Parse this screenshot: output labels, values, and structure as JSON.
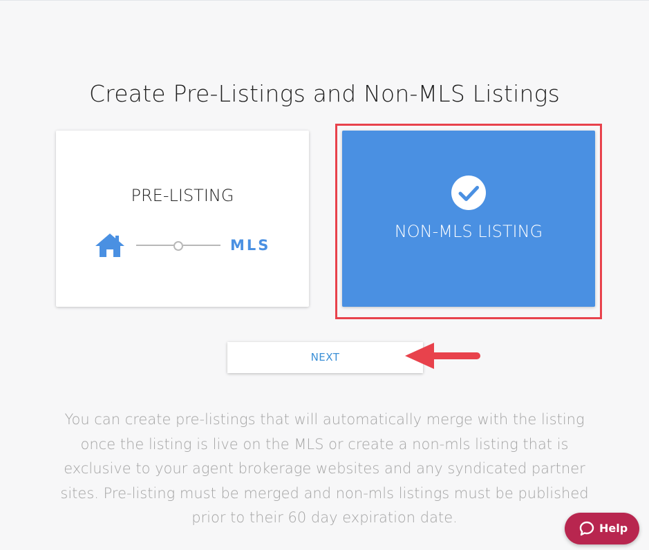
{
  "page": {
    "title": "Create Pre-Listings and Non-MLS Listings"
  },
  "cards": {
    "pre_listing": {
      "label": "PRE-LISTING",
      "icon": "home-icon",
      "mls_label": "MLS",
      "selected": false
    },
    "non_mls": {
      "label": "NON-MLS LISTING",
      "icon": "checkmark-circle-icon",
      "selected": true
    }
  },
  "actions": {
    "next_label": "NEXT"
  },
  "description": "You can create pre-listings that will automatically merge with the listing once the listing is live on the MLS or create a non-mls listing that is exclusive to your agent brokerage websites and any syndicated partner sites. Pre-listing must be merged and non-mls listings must be published prior to their 60 day expiration date.",
  "help": {
    "label": "Help",
    "icon": "chat-bubble-icon"
  },
  "colors": {
    "background": "#f7f7f8",
    "accent_blue": "#4a90e2",
    "highlight_red": "#e8424c",
    "help_button": "#b8264f",
    "description_text": "#a4a4a4"
  }
}
